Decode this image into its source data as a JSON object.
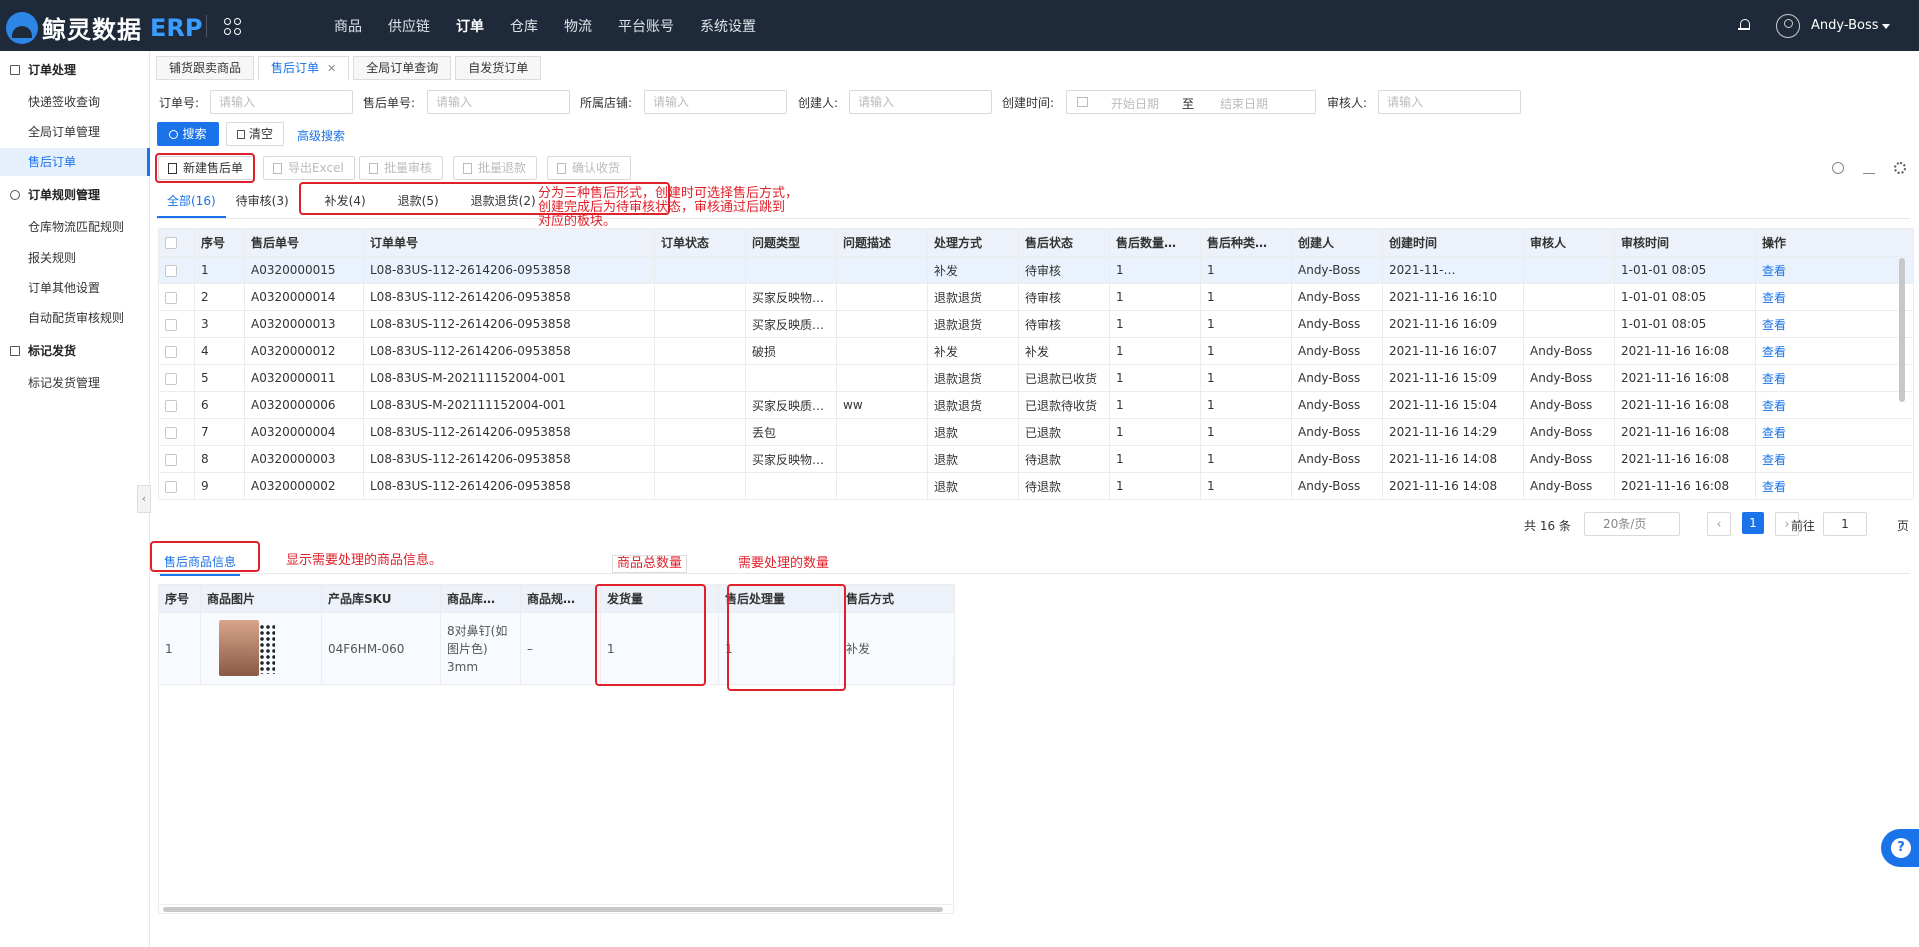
{
  "app": {
    "brand": "鲸灵数据",
    "brand_suffix": "ERP",
    "user": "Andy-Boss"
  },
  "topnav": [
    "商品",
    "供应链",
    "订单",
    "仓库",
    "物流",
    "平台账号",
    "系统设置"
  ],
  "sidebar": {
    "group1": "订单处理",
    "group1_items": [
      "快递签收查询",
      "全局订单管理",
      "售后订单"
    ],
    "group2": "订单规则管理",
    "group2_items": [
      "仓库物流匹配规则",
      "报关规则",
      "订单其他设置",
      "自动配货审核规则"
    ],
    "group3": "标记发货",
    "group3_items": [
      "标记发货管理"
    ],
    "collapse": "‹"
  },
  "tabs": [
    "铺货跟卖商品",
    "售后订单",
    "全局订单查询",
    "自发货订单"
  ],
  "filters": {
    "order_no": "订单号:",
    "after_no": "售后单号:",
    "store": "所属店铺:",
    "creator": "创建人:",
    "created_time": "创建时间:",
    "reviewer": "审核人:",
    "placeholder": "请输入",
    "start_date": "开始日期",
    "to": "至",
    "end_date": "结束日期"
  },
  "actions": {
    "search": "搜索",
    "clear": "清空",
    "advanced": "高级搜索"
  },
  "toolbar": [
    "新建售后单",
    "导出Excel",
    "批量审核",
    "批量退款",
    "确认收货"
  ],
  "subtabs": [
    "全部(16)",
    "待审核(3)",
    "补发(4)",
    "退款(5)",
    "退款退货(2)"
  ],
  "annotations": {
    "types_note_1": "分为三种售后形式，创建时可选择售后方式，",
    "types_note_2": "创建完成后为待审核状态，审核通过后跳到",
    "types_note_3": "对应的板块。",
    "goods_info": "显示需要处理的商品信息。",
    "total_qty": "商品总数量",
    "process_qty": "需要处理的数量"
  },
  "grid": {
    "columns": [
      "序号",
      "售后单号",
      "订单单号",
      "订单状态",
      "问题类型",
      "问题描述",
      "处理方式",
      "售后状态",
      "售后数量…",
      "售后种类…",
      "创建人",
      "创建时间",
      "审核人",
      "审核时间",
      "操作"
    ],
    "rows": [
      [
        "1",
        "A0320000015",
        "L08-83US-112-2614206-0953858",
        "",
        "",
        "",
        "补发",
        "待审核",
        "1",
        "1",
        "Andy-Boss",
        "2021-11-…",
        "",
        "1-01-01 08:05",
        "查看"
      ],
      [
        "2",
        "A0320000014",
        "L08-83US-112-2614206-0953858",
        "",
        "买家反映物…",
        "",
        "退款退货",
        "待审核",
        "1",
        "1",
        "Andy-Boss",
        "2021-11-16 16:10",
        "",
        "1-01-01 08:05",
        "查看"
      ],
      [
        "3",
        "A0320000013",
        "L08-83US-112-2614206-0953858",
        "",
        "买家反映质…",
        "",
        "退款退货",
        "待审核",
        "1",
        "1",
        "Andy-Boss",
        "2021-11-16 16:09",
        "",
        "1-01-01 08:05",
        "查看"
      ],
      [
        "4",
        "A0320000012",
        "L08-83US-112-2614206-0953858",
        "",
        "破损",
        "",
        "补发",
        "补发",
        "1",
        "1",
        "Andy-Boss",
        "2021-11-16 16:07",
        "Andy-Boss",
        "2021-11-16 16:08",
        "查看"
      ],
      [
        "5",
        "A0320000011",
        "L08-83US-M-202111152004-001",
        "",
        "",
        "",
        "退款退货",
        "已退款已收货",
        "1",
        "1",
        "Andy-Boss",
        "2021-11-16 15:09",
        "Andy-Boss",
        "2021-11-16 16:08",
        "查看"
      ],
      [
        "6",
        "A0320000006",
        "L08-83US-M-202111152004-001",
        "",
        "买家反映质…",
        "ww",
        "退款退货",
        "已退款待收货",
        "1",
        "1",
        "Andy-Boss",
        "2021-11-16 15:04",
        "Andy-Boss",
        "2021-11-16 16:08",
        "查看"
      ],
      [
        "7",
        "A0320000004",
        "L08-83US-112-2614206-0953858",
        "",
        "丢包",
        "",
        "退款",
        "已退款",
        "1",
        "1",
        "Andy-Boss",
        "2021-11-16 14:29",
        "Andy-Boss",
        "2021-11-16 16:08",
        "查看"
      ],
      [
        "8",
        "A0320000003",
        "L08-83US-112-2614206-0953858",
        "",
        "买家反映物…",
        "",
        "退款",
        "待退款",
        "1",
        "1",
        "Andy-Boss",
        "2021-11-16 14:08",
        "Andy-Boss",
        "2021-11-16 16:08",
        "查看"
      ],
      [
        "9",
        "A0320000002",
        "L08-83US-112-2614206-0953858",
        "",
        "",
        "",
        "退款",
        "待退款",
        "1",
        "1",
        "Andy-Boss",
        "2021-11-16 14:08",
        "Andy-Boss",
        "2021-11-16 16:08",
        "查看"
      ]
    ]
  },
  "pager": {
    "total": "共 16 条",
    "page_size": "20条/页",
    "current": "1",
    "goto_label": "前往",
    "goto_value": "1",
    "page_unit": "页"
  },
  "product_section": {
    "tab": "售后商品信息",
    "columns": [
      "序号",
      "商品图片",
      "产品库SKU",
      "商品库…",
      "商品规…",
      "发货量",
      "售后处理量",
      "售后方式"
    ],
    "row": {
      "index": "1",
      "sku": "04F6HM-060",
      "name": "8对鼻钉(如图片色) 3mm",
      "spec": "–",
      "shipped": "1",
      "process_qty": "1",
      "method": "补发"
    }
  }
}
